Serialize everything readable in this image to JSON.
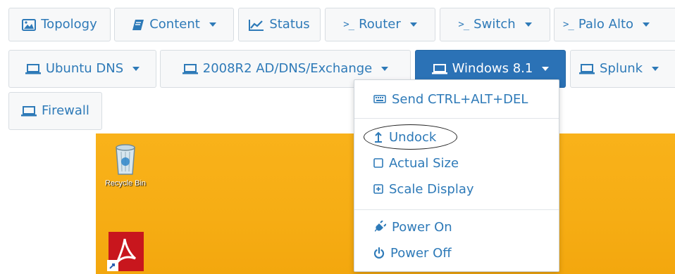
{
  "tabs_row1": [
    {
      "label": "Topology",
      "icon": "image-icon",
      "has_caret": false
    },
    {
      "label": "Content",
      "icon": "book-icon",
      "has_caret": true
    },
    {
      "label": "Status",
      "icon": "line-chart-icon",
      "has_caret": false
    },
    {
      "label": "Router",
      "icon": "terminal-icon",
      "glyph": ">_",
      "has_caret": true
    },
    {
      "label": "Switch",
      "icon": "terminal-icon",
      "glyph": ">_",
      "has_caret": true
    },
    {
      "label": "Palo Alto",
      "icon": "terminal-icon",
      "glyph": ">_",
      "has_caret": true
    }
  ],
  "tabs_row2": [
    {
      "label": "Ubuntu DNS",
      "icon": "laptop-icon",
      "has_caret": true
    },
    {
      "label": "2008R2 AD/DNS/Exchange",
      "icon": "laptop-icon",
      "has_caret": true
    },
    {
      "label": "Windows 8.1",
      "icon": "laptop-icon",
      "has_caret": true,
      "active": true
    },
    {
      "label": "Splunk",
      "icon": "laptop-icon",
      "has_caret": true
    }
  ],
  "tabs_row3": [
    {
      "label": "Firewall",
      "icon": "laptop-icon",
      "has_caret": false
    }
  ],
  "dropdown": {
    "items": [
      {
        "label": "Send CTRL+ALT+DEL",
        "icon": "keyboard-icon"
      },
      {
        "label": "Undock",
        "icon": "undock-arrow-icon",
        "highlighted_by_annotation": true
      },
      {
        "label": "Actual Size",
        "icon": "square-icon"
      },
      {
        "label": "Scale Display",
        "icon": "plus-square-icon"
      },
      {
        "label": "Power On",
        "icon": "plug-icon"
      },
      {
        "label": "Power Off",
        "icon": "power-icon"
      }
    ]
  },
  "desktop": {
    "recycle_bin_label": "Recycle Bin",
    "background_color": "#f6ad14"
  },
  "colors": {
    "accent": "#2e7ab8",
    "active_tab": "#2b72b6",
    "tab_bg": "#f7f8f9",
    "border": "#d8dde2"
  }
}
